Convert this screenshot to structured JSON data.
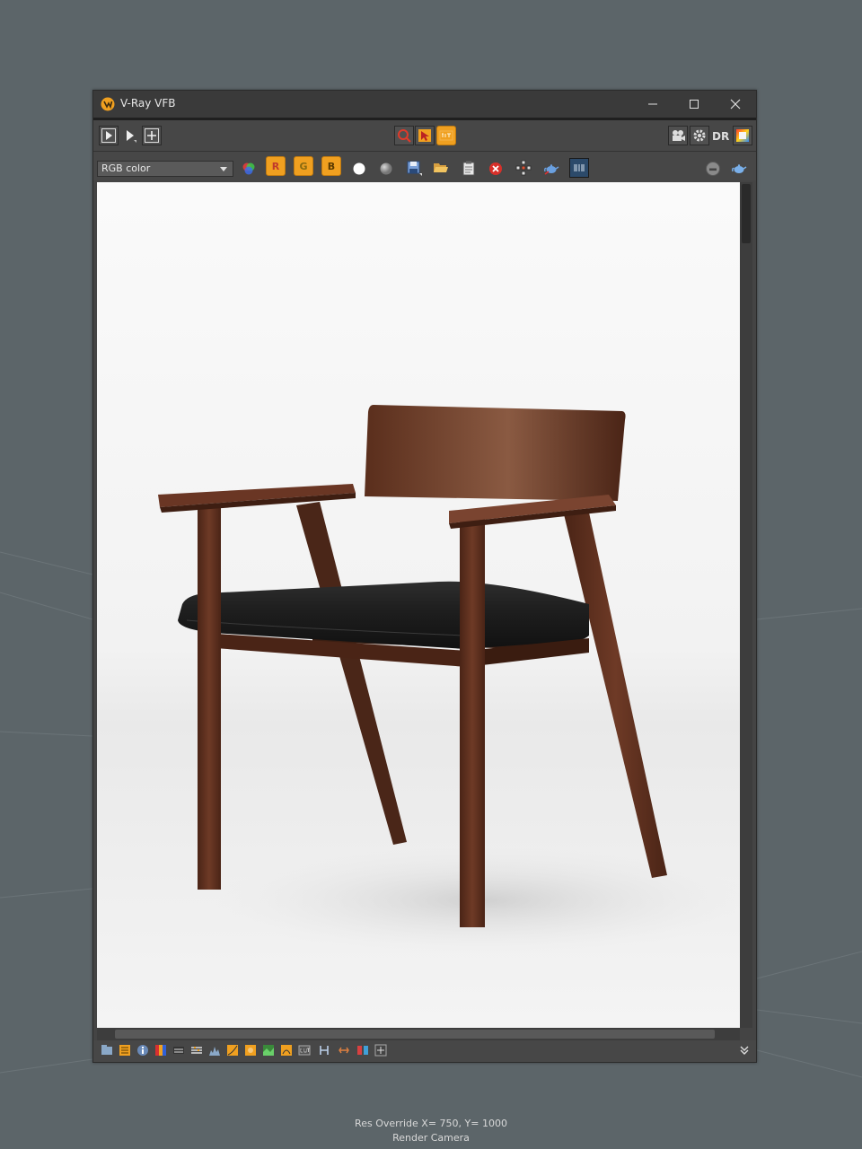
{
  "window": {
    "title": "V-Ray VFB"
  },
  "toolbar": {
    "dr_label": "DR",
    "channel": "RGB color",
    "r_label": "R",
    "g_label": "G",
    "b_label": "B"
  },
  "status": {
    "res_override": "Res Override  X= 750, Y= 1000",
    "camera": "Render Camera"
  },
  "colors": {
    "viewport_bg": "#5c6569",
    "window_bg": "#444444",
    "accent_orange": "#f0a020",
    "wood": "#5a2e1e",
    "leather": "#1e1e1e"
  }
}
